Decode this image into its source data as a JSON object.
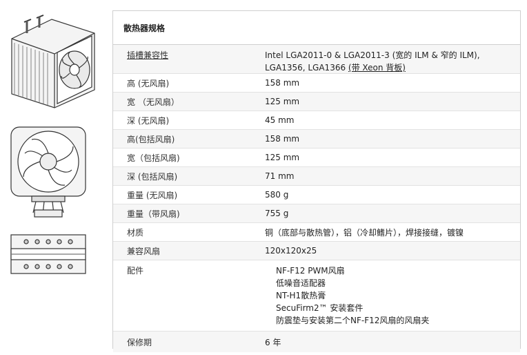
{
  "spec": {
    "title": "散热器规格",
    "rows": [
      {
        "label": "插槽兼容性",
        "value_line1": "Intel LGA2011-0 & LGA2011-3 (宽的 ILM & 窄的 ILM),",
        "value_line2a": "LGA1356, LGA1366 ",
        "value_line2b": "(带 Xeon 背板)"
      },
      {
        "label": "高 (无风扇)",
        "value": "158 mm"
      },
      {
        "label": "宽 （无风扇）",
        "value": "125 mm"
      },
      {
        "label": "深 (无风扇)",
        "value": "45 mm"
      },
      {
        "label": "高(包括风扇)",
        "value": "158 mm"
      },
      {
        "label": "宽（包括风扇)",
        "value": "125 mm"
      },
      {
        "label": "深 (包括风扇)",
        "value": "71 mm"
      },
      {
        "label": "重量 (无风扇)",
        "value": "580 g"
      },
      {
        "label": "重量（带风扇)",
        "value": "755 g"
      },
      {
        "label": "材质",
        "value": "铜（底部与散热管），铝（冷却鳍片），焊接接缝，镀镍"
      },
      {
        "label": "兼容风扇",
        "value": "120x120x25"
      },
      {
        "label": "配件",
        "items": [
          "NF-F12 PWM风扇",
          "低噪音适配器",
          "NT-H1散热膏",
          "SecuFirm2™ 安装套件",
          "防震垫与安装第二个NF-F12风扇的风扇夹"
        ]
      },
      {
        "label": "保修期",
        "value": "6 年"
      }
    ]
  }
}
